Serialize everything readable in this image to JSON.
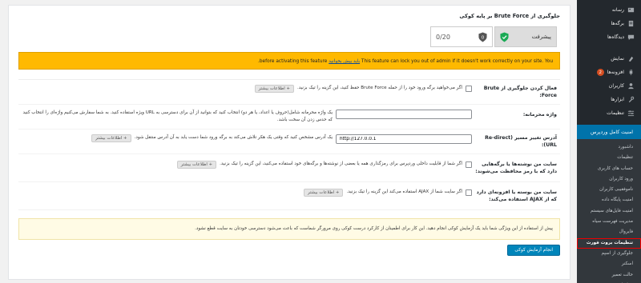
{
  "sidebar": {
    "top_items": [
      {
        "label": "رسانه",
        "icon": "media-icon"
      },
      {
        "label": "برگه‌ها",
        "icon": "pages-icon"
      },
      {
        "label": "دیدگاه‌ها",
        "icon": "comments-icon"
      }
    ],
    "mid_items": [
      {
        "label": "نمایش",
        "icon": "appearance-icon"
      },
      {
        "label": "افزونه‌ها",
        "icon": "plugins-icon",
        "badge": "2"
      },
      {
        "label": "کاربران",
        "icon": "users-icon"
      },
      {
        "label": "ابزارها",
        "icon": "tools-icon"
      },
      {
        "label": "تنظیمات",
        "icon": "settings-icon"
      }
    ],
    "active": {
      "label": "امنیت کامل وردپرس",
      "icon": "gear-icon"
    },
    "submenu": [
      "داشبورد",
      "تنظیمات",
      "حساب های کاربری",
      "ورود کاربران",
      "ناموفقیبی کاربران",
      "امنیت پایگاه داده",
      "امنیت فایل‌های سیستم",
      "مدیریت فهرست سیاه",
      "فایروال",
      "تنظیمات بروت فورث",
      "جلوگیری از اسپم",
      "اسکنر",
      "حالت تعمیر",
      "تنظیمات بیشتر"
    ],
    "current_index": 9,
    "colors": {
      "bg": "#23282d",
      "sub_bg": "#32373c",
      "active": "#0073aa",
      "badge": "#d54e21"
    }
  },
  "main": {
    "heading": "جلوگیری از Brute Force بر پایه کوکی",
    "stats": {
      "progress_label": "پیشرفت",
      "score": "0/20"
    },
    "warning": {
      "text_before": "This feature can lock you out of admin if it doesn't work correctly on your site. You",
      "link": "باید بیش بخوانید",
      "text_after": "before activating this feature."
    },
    "rows": {
      "enable": {
        "label": "فعال کردن جلوگیری از Brute Force:",
        "text": "اگر می‌خواهید برگه ورود خود را از حمله Brute Force حفظ کنید، این گزینه را تیک بزنید.",
        "more": "+ اطلاعات بیشتر"
      },
      "secret": {
        "label": "واژه محرمانه:",
        "value": "",
        "text": "یک واژه محرمانه شامل(حروف یا اعداد، یا هر دو) انتخاب کنید که بتوانید از آن برای دسترسی به URL ویژه استفاده کنید. به شما سفارش می‌کنیم واژه‌ای را انتخاب کنید که حدس زدن آن سخت باشد."
      },
      "redirect": {
        "label": "آدرس تغییر مسیر (Re-direct URL):",
        "value": "http://127.0.0.1",
        "text": "یک آدرس مشخص کنید که وقتی یک هکر تلاش می‌کند به برگه ورود شما دست یابد به آن آدرس منتقل شود.",
        "more": "+ اطلاعات بیشتر"
      },
      "protected": {
        "label": "سایت من نوشته‌ها یا برگه‌هایی دارد که با رمز محافظت می‌شوند:",
        "text": "اگر شما از قابلیت داخلی وردپرس برای رمزگذاری همه یا بعضی از نوشته‌ها و برگه‌های خود استفاده می‌کنید، این گزینه را تیک بزنید.",
        "more": "+ اطلاعات بیشتر"
      },
      "ajax": {
        "label": "سایت من بوسته یا افزونه‌ای دارد که از AJAX استفاده می‌کند:",
        "text": "اگر سایت شما از AJAX استفاده می‌کند این گزینه را تیک بزنید.",
        "more": "+ اطلاعات بیشتر"
      }
    },
    "note": "پیش از استفاده از این ویژگی شما باید یک آزمایش کوکی انجام دهید. این کار برای اطمینان از کارکرد درست کوکی روی مرورگر شماست که باعث می‌شود دسترسی خودتان به سایت قطع نشود.",
    "test_button": "انجام آزمایش کوکی",
    "colors": {
      "warning": "#ffb900",
      "note_bg": "#fffbe5",
      "button": "#0085ba"
    }
  }
}
